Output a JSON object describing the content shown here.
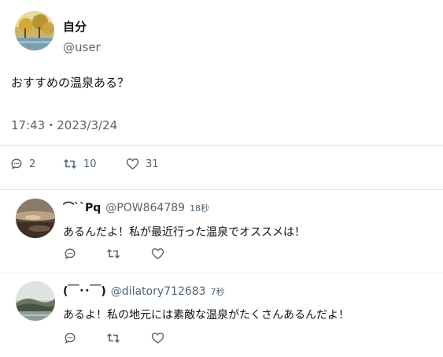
{
  "tweet": {
    "author_name": "自分",
    "author_handle": "@user",
    "text": "おすすめの温泉ある？",
    "timestamp": "17:43・2023/3/24",
    "stats": {
      "replies": "2",
      "retweets": "10",
      "likes": "31"
    }
  },
  "replies": [
    {
      "name": "⌒``Pq",
      "handle": "@POW864789",
      "time": "18秒",
      "text": "あるんだよ！私が最近行った温泉でオススメは！"
    },
    {
      "name": "(￣･･￣)",
      "handle": "@dilatory712683",
      "time": "7秒",
      "text": "あるよ！私の地元には素敵な温泉がたくさんあるんだよ！"
    }
  ],
  "icons": {
    "reply": "reply-icon",
    "retweet": "retweet-icon",
    "like": "heart-icon"
  }
}
